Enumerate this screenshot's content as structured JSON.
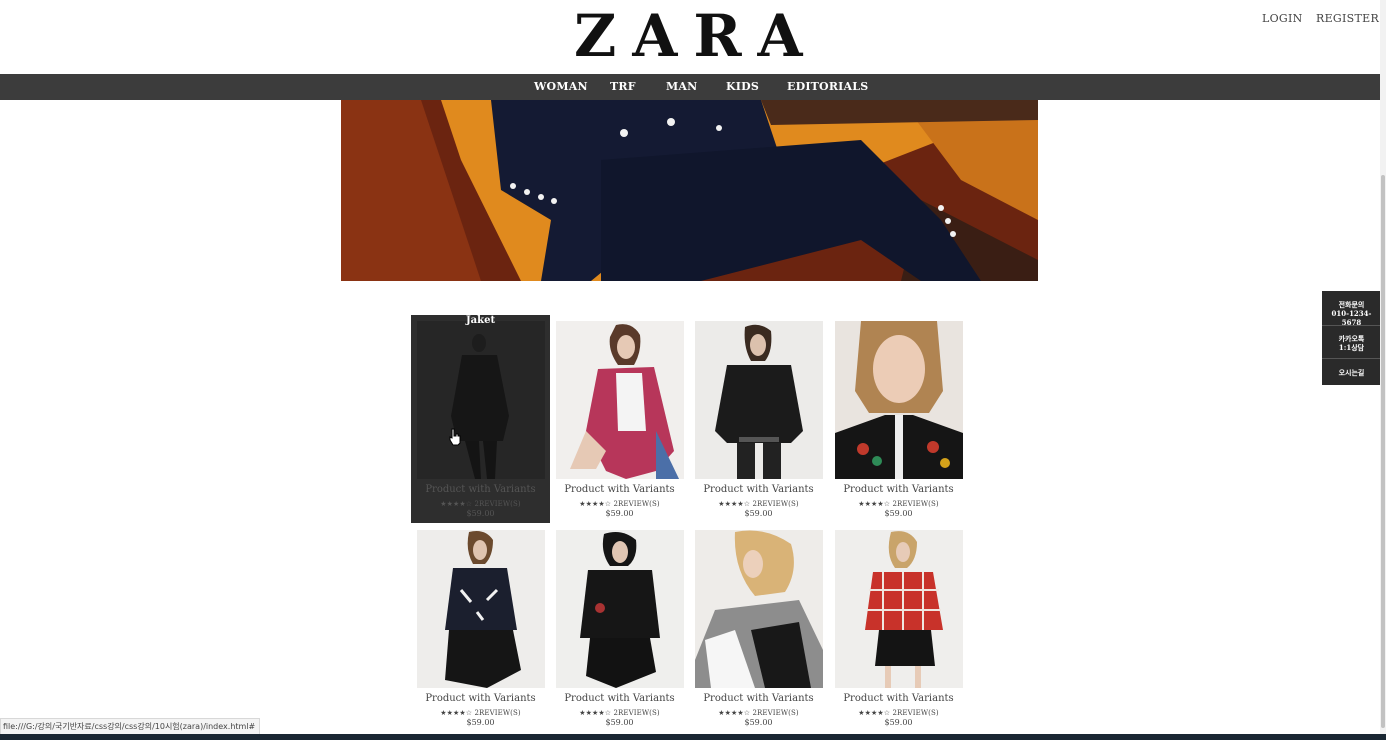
{
  "header": {
    "logo": "ZARA",
    "login": "LOGIN",
    "register": "REGISTER"
  },
  "nav": [
    "WOMAN",
    "TRF",
    "MAN",
    "KIDS",
    "EDITORIALS"
  ],
  "hero": {
    "icon": "hero-banner-photo"
  },
  "products": {
    "hover_title": "Jaket",
    "items": [
      {
        "name": "Product with Variants",
        "rating": "★★★★☆ 2REVIEW(S)",
        "price": "$59.00",
        "image": "jacket-dark-floral"
      },
      {
        "name": "Product with Variants",
        "rating": "★★★★☆ 2REVIEW(S)",
        "price": "$59.00",
        "image": "tweed-jacket"
      },
      {
        "name": "Product with Variants",
        "rating": "★★★★☆ 2REVIEW(S)",
        "price": "$59.00",
        "image": "leather-fringe-jacket"
      },
      {
        "name": "Product with Variants",
        "rating": "★★★★☆ 2REVIEW(S)",
        "price": "$59.00",
        "image": "embroidered-bomber"
      },
      {
        "name": "Product with Variants",
        "rating": "★★★★☆ 2REVIEW(S)",
        "price": "$59.00",
        "image": "printed-bomber"
      },
      {
        "name": "Product with Variants",
        "rating": "★★★★☆ 2REVIEW(S)",
        "price": "$59.00",
        "image": "leather-biker-jacket"
      },
      {
        "name": "Product with Variants",
        "rating": "★★★★☆ 2REVIEW(S)",
        "price": "$59.00",
        "image": "gingham-jacket"
      },
      {
        "name": "Product with Variants",
        "rating": "★★★★☆ 2REVIEW(S)",
        "price": "$59.00",
        "image": "red-check-jacket"
      }
    ]
  },
  "side_menu": {
    "item1_line1": "전화문의",
    "item1_line2": "010-1234-5678",
    "item2_line1": "카카오톡",
    "item2_line2": "1:1상담",
    "item3": "오시는길"
  },
  "status_bar": "file:///G:/강의/국기반자료/css강의/css강의/10시험(zara)/index.html#",
  "colors": {
    "nav_bg": "#3c3c3c",
    "hover_overlay": "#2e2e2e",
    "side_menu_bg": "#2a2a2a"
  }
}
